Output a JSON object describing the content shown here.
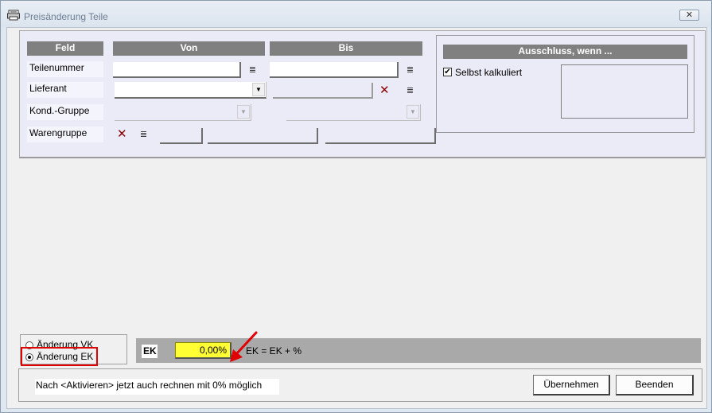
{
  "window": {
    "title": "Preisänderung Teile",
    "close_glyph": "✕"
  },
  "headers": {
    "feld": "Feld",
    "von": "Von",
    "bis": "Bis",
    "ausschluss": "Ausschluss, wenn ..."
  },
  "rows": {
    "teilenummer": "Teilenummer",
    "lieferant": "Lieferant",
    "kond_gruppe": "Kond.-Gruppe",
    "warengruppe": "Warengruppe"
  },
  "exclusion": {
    "selbst_kalkuliert": "Selbst kalkuliert",
    "checked": true
  },
  "radio": {
    "vk": "Änderung VK",
    "ek": "Änderung EK",
    "selected": "ek"
  },
  "ek": {
    "label": "EK",
    "value": "0,00%",
    "formula": "EK = EK +  %",
    "input_color": "#ffff33"
  },
  "status": {
    "text": "Nach <Aktivieren> jetzt auch rechnen mit 0% möglich"
  },
  "buttons": {
    "uebernehmen": "Übernehmen",
    "beenden": "Beenden"
  },
  "icons": {
    "list": "list-icon",
    "clear": "clear-x-icon",
    "dropdown": "chevron-down-icon"
  },
  "colors": {
    "highlight_box": "#e00000",
    "arrow": "#e00000",
    "header_bg": "#808080"
  }
}
